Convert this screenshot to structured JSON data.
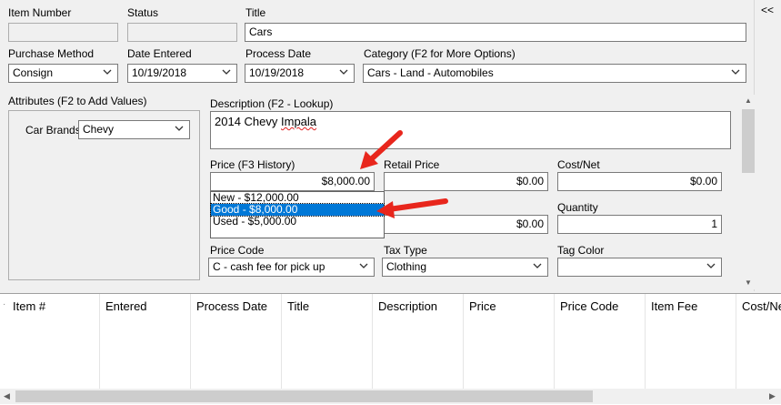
{
  "collapse_label": "<<",
  "labels": {
    "item_number": "Item Number",
    "status": "Status",
    "title": "Title",
    "purchase_method": "Purchase Method",
    "date_entered": "Date Entered",
    "process_date": "Process Date",
    "category": "Category (F2 for More Options)",
    "attributes": "Attributes (F2 to Add Values)",
    "car_brands": "Car Brands",
    "description": "Description (F2 - Lookup)",
    "price": "Price (F3 History)",
    "retail_price": "Retail Price",
    "cost_net": "Cost/Net",
    "quantity": "Quantity",
    "price_code": "Price Code",
    "tax_type": "Tax Type",
    "tag_color": "Tag Color"
  },
  "values": {
    "item_number": "",
    "status": "",
    "title": "Cars",
    "purchase_method": "Consign",
    "date_entered": "10/19/2018",
    "process_date": "10/19/2018",
    "category": "Cars - Land - Automobiles",
    "car_brands": "Chevy",
    "description_part1": "2014 Chevy ",
    "description_part2": "Impala",
    "price": "$8,000.00",
    "retail_price": "$0.00",
    "cost_net": "$0.00",
    "mid_price": "$0.00",
    "quantity": "1",
    "price_code": "C - cash fee for pick up",
    "tax_type": "Clothing",
    "tag_color": ""
  },
  "price_history": [
    "New - $12,000.00",
    "Good - $8,000.00",
    "Used - $5,000.00"
  ],
  "grid_columns": [
    "Item #",
    "Entered",
    "Process Date",
    "Title",
    "Description",
    "Price",
    "Price Code",
    "Item Fee",
    "Cost/Ne"
  ],
  "colors": {
    "selection": "#0078d7",
    "arrow": "#e8261c"
  }
}
